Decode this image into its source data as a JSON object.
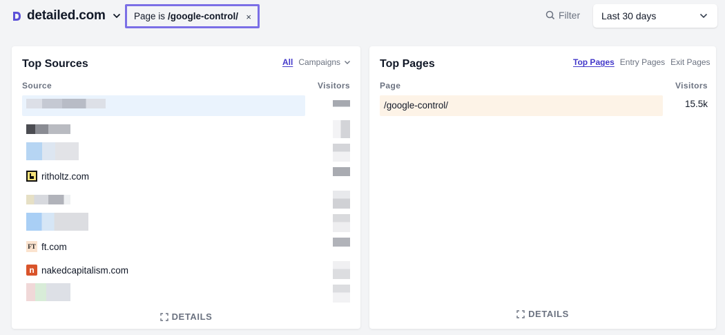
{
  "header": {
    "site_name": "detailed.com",
    "filter_pill": {
      "prefix": "Page is",
      "value": "/google-control/",
      "close": "×"
    },
    "filter_button": "Filter",
    "date_range": "Last 30 days"
  },
  "sources_card": {
    "title": "Top Sources",
    "tabs": [
      "All",
      "Campaigns"
    ],
    "column_source": "Source",
    "column_visitors": "Visitors",
    "rows": [
      {
        "label": "",
        "obscured": true
      },
      {
        "label": "",
        "obscured": true
      },
      {
        "label": "",
        "obscured": true
      },
      {
        "label": "ritholtz.com",
        "icon": "ritholtz-favicon-icon"
      },
      {
        "label": "",
        "obscured": true
      },
      {
        "label": "",
        "obscured": true
      },
      {
        "label": "ft.com",
        "icon": "ft-favicon-icon",
        "icon_text": "FT"
      },
      {
        "label": "nakedcapitalism.com",
        "icon": "nakedcapitalism-favicon-icon",
        "icon_text": "n"
      },
      {
        "label": "",
        "obscured": true
      }
    ],
    "details": "DETAILS"
  },
  "pages_card": {
    "title": "Top Pages",
    "tabs": [
      "Top Pages",
      "Entry Pages",
      "Exit Pages"
    ],
    "column_page": "Page",
    "column_visitors": "Visitors",
    "rows": [
      {
        "label": "/google-control/",
        "visitors": "15.5k",
        "share": 1.0
      }
    ],
    "details": "DETAILS"
  },
  "colors": {
    "accent": "#4338ca",
    "pill_border": "#7b6fe6",
    "source_bar": "#eaf3fd",
    "page_bar": "#fdf3e7"
  }
}
